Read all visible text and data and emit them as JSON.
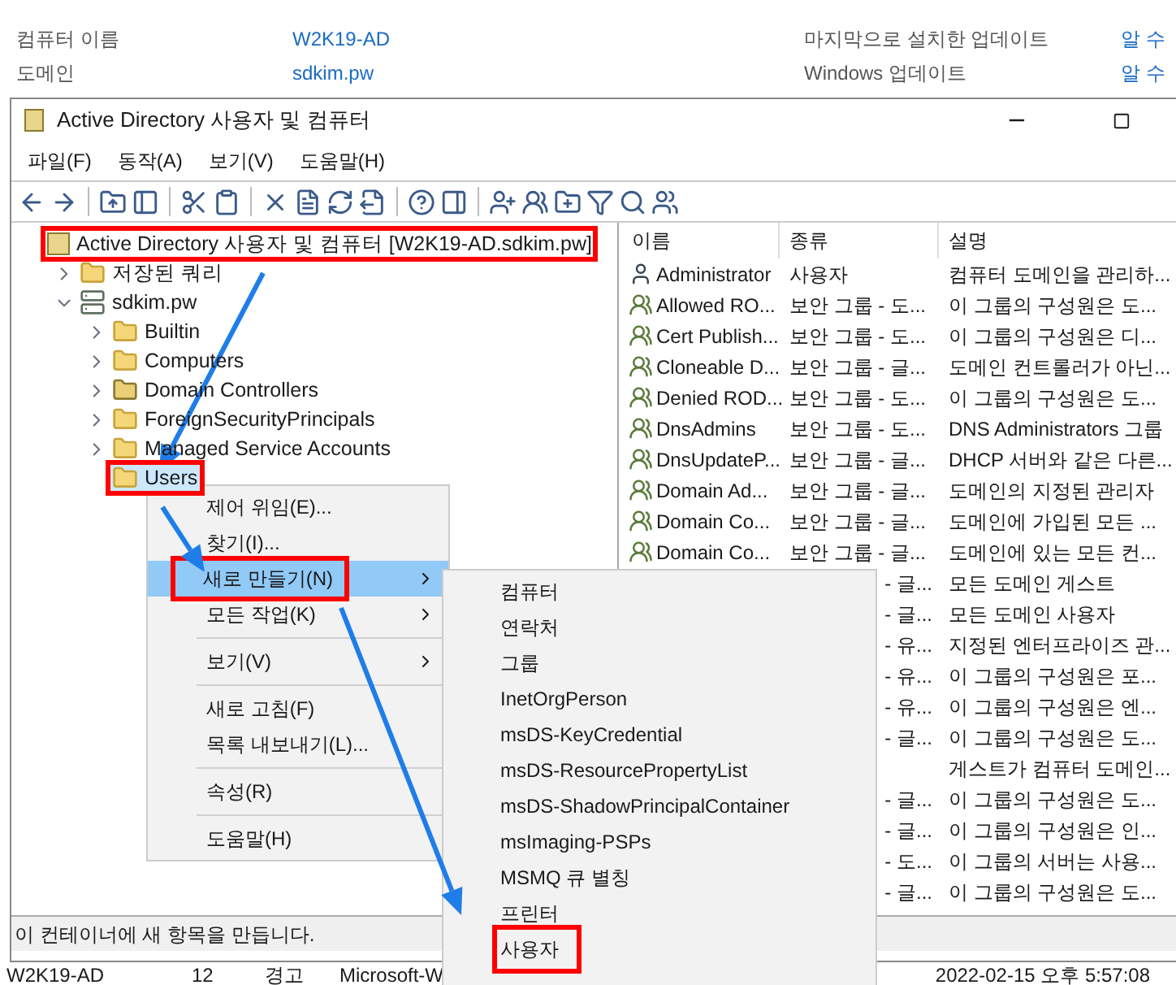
{
  "server_info": {
    "rows": [
      {
        "label": "컴퓨터 이름",
        "value": "W2K19-AD",
        "label_2": "마지막으로 설치한 업데이트",
        "value_2": "알 수"
      },
      {
        "label": "도메인",
        "value": "sdkim.pw",
        "label_2": "Windows 업데이트",
        "value_2": "알 수"
      }
    ]
  },
  "window": {
    "title": "Active Directory 사용자 및 컴퓨터",
    "menu": [
      "파일(F)",
      "동작(A)",
      "보기(V)",
      "도움말(H)"
    ],
    "tree": {
      "label": "Active Directory 사용자 및 컴퓨터 [W2K19-AD.sdkim.pw]",
      "kind": "root",
      "annotated": true,
      "children": [
        {
          "label": "저장된 쿼리",
          "kind": "folder",
          "expanded": false
        },
        {
          "label": "sdkim.pw",
          "kind": "domain",
          "expanded": true,
          "children": [
            {
              "label": "Builtin",
              "kind": "folder",
              "expanded": false
            },
            {
              "label": "Computers",
              "kind": "folder",
              "expanded": false
            },
            {
              "label": "Domain Controllers",
              "kind": "ou",
              "expanded": false
            },
            {
              "label": "ForeignSecurityPrincipals",
              "kind": "folder",
              "expanded": false
            },
            {
              "label": "Managed Service Accounts",
              "kind": "folder",
              "expanded": false
            },
            {
              "label": "Users",
              "kind": "folder",
              "selected": true,
              "annotated": true
            }
          ]
        }
      ]
    },
    "list": {
      "columns": [
        "이름",
        "종류",
        "설명"
      ],
      "rows": [
        {
          "name": "Administrator",
          "kind": "user",
          "type": "사용자",
          "description": "컴퓨터 도메인을 관리하..."
        },
        {
          "name": "Allowed RO...",
          "kind": "group",
          "type": "보안 그룹 - 도...",
          "description": "이 그룹의 구성원은 도..."
        },
        {
          "name": "Cert Publish...",
          "kind": "group",
          "type": "보안 그룹 - 도...",
          "description": "이 그룹의 구성원은 디..."
        },
        {
          "name": "Cloneable D...",
          "kind": "group",
          "type": "보안 그룹 - 글...",
          "description": "도메인 컨트롤러가 아닌..."
        },
        {
          "name": "Denied ROD...",
          "kind": "group",
          "type": "보안 그룹 - 도...",
          "description": "이 그룹의 구성원은 도..."
        },
        {
          "name": "DnsAdmins",
          "kind": "group",
          "type": "보안 그룹 - 도...",
          "description": "DNS Administrators 그룹"
        },
        {
          "name": "DnsUpdateP...",
          "kind": "group",
          "type": "보안 그룹 - 글...",
          "description": "DHCP 서버와 같은 다른..."
        },
        {
          "name": "Domain Ad...",
          "kind": "group",
          "type": "보안 그룹 - 글...",
          "description": "도메인의 지정된 관리자"
        },
        {
          "name": "Domain Co...",
          "kind": "group",
          "type": "보안 그룹 - 글...",
          "description": "도메인에 가입된 모든 ..."
        },
        {
          "name": "Domain Co...",
          "kind": "group",
          "type": "보안 그룹 - 글...",
          "description": "도메인에 있는 모든 컨..."
        },
        {
          "type": "- 글...",
          "description": "모든 도메인 게스트"
        },
        {
          "type": "- 글...",
          "description": "모든 도메인 사용자"
        },
        {
          "type": "- 유...",
          "description": "지정된 엔터프라이즈 관..."
        },
        {
          "type": "- 유...",
          "description": "이 그룹의 구성원은 포..."
        },
        {
          "type": "- 유...",
          "description": "이 그룹의 구성원은 엔..."
        },
        {
          "type": "- 글...",
          "description": "이 그룹의 구성원은 도..."
        },
        {
          "description": "게스트가 컴퓨터 도메인..."
        },
        {
          "type": "- 글...",
          "description": "이 그룹의 구성원은 도..."
        },
        {
          "type": "- 글...",
          "description": "이 그룹의 구성원은 인..."
        },
        {
          "type": "- 도...",
          "description": "이 그룹의 서버는 사용..."
        },
        {
          "type": "- 글...",
          "description": "이 그룹의 구성원은 도..."
        }
      ]
    },
    "status_bar": "이 컨테이너에 새 항목을 만듭니다."
  },
  "context_menu": {
    "items": [
      {
        "kind": "item",
        "label": "제어 위임(E)...",
        "submenu": false,
        "selected": false,
        "annotated": false
      },
      {
        "kind": "item",
        "label": "찾기(I)...",
        "submenu": false,
        "selected": false,
        "annotated": false
      },
      {
        "kind": "item",
        "label": "새로 만들기(N)",
        "submenu": true,
        "selected": true,
        "annotated": true
      },
      {
        "kind": "item",
        "label": "모든 작업(K)",
        "submenu": true,
        "selected": false,
        "annotated": false
      },
      {
        "kind": "separator"
      },
      {
        "kind": "item",
        "label": "보기(V)",
        "submenu": true,
        "selected": false,
        "annotated": false
      },
      {
        "kind": "separator"
      },
      {
        "kind": "item",
        "label": "새로 고침(F)",
        "submenu": false,
        "selected": false,
        "annotated": false
      },
      {
        "kind": "item",
        "label": "목록 내보내기(L)...",
        "submenu": false,
        "selected": false,
        "annotated": false
      },
      {
        "kind": "separator"
      },
      {
        "kind": "item",
        "label": "속성(R)",
        "submenu": false,
        "selected": false,
        "annotated": false
      },
      {
        "kind": "separator"
      },
      {
        "kind": "item",
        "label": "도움말(H)",
        "submenu": false,
        "selected": false,
        "annotated": false
      }
    ]
  },
  "submenu": {
    "items": [
      {
        "label": "컴퓨터",
        "annotated": false
      },
      {
        "label": "연락처",
        "annotated": false
      },
      {
        "label": "그룹",
        "annotated": false
      },
      {
        "label": "InetOrgPerson",
        "annotated": false
      },
      {
        "label": "msDS-KeyCredential",
        "annotated": false
      },
      {
        "label": "msDS-ResourcePropertyList",
        "annotated": false
      },
      {
        "label": "msDS-ShadowPrincipalContainer",
        "annotated": false
      },
      {
        "label": "msImaging-PSPs",
        "annotated": false
      },
      {
        "label": "MSMQ 큐 별칭",
        "annotated": false
      },
      {
        "label": "프린터",
        "annotated": false
      },
      {
        "label": "사용자",
        "annotated": true
      }
    ]
  },
  "event_row": {
    "cells": [
      "W2K19-AD",
      "12",
      "경고",
      "Microsoft-W"
    ],
    "time": "2022-02-15 오후 5:57:08"
  }
}
